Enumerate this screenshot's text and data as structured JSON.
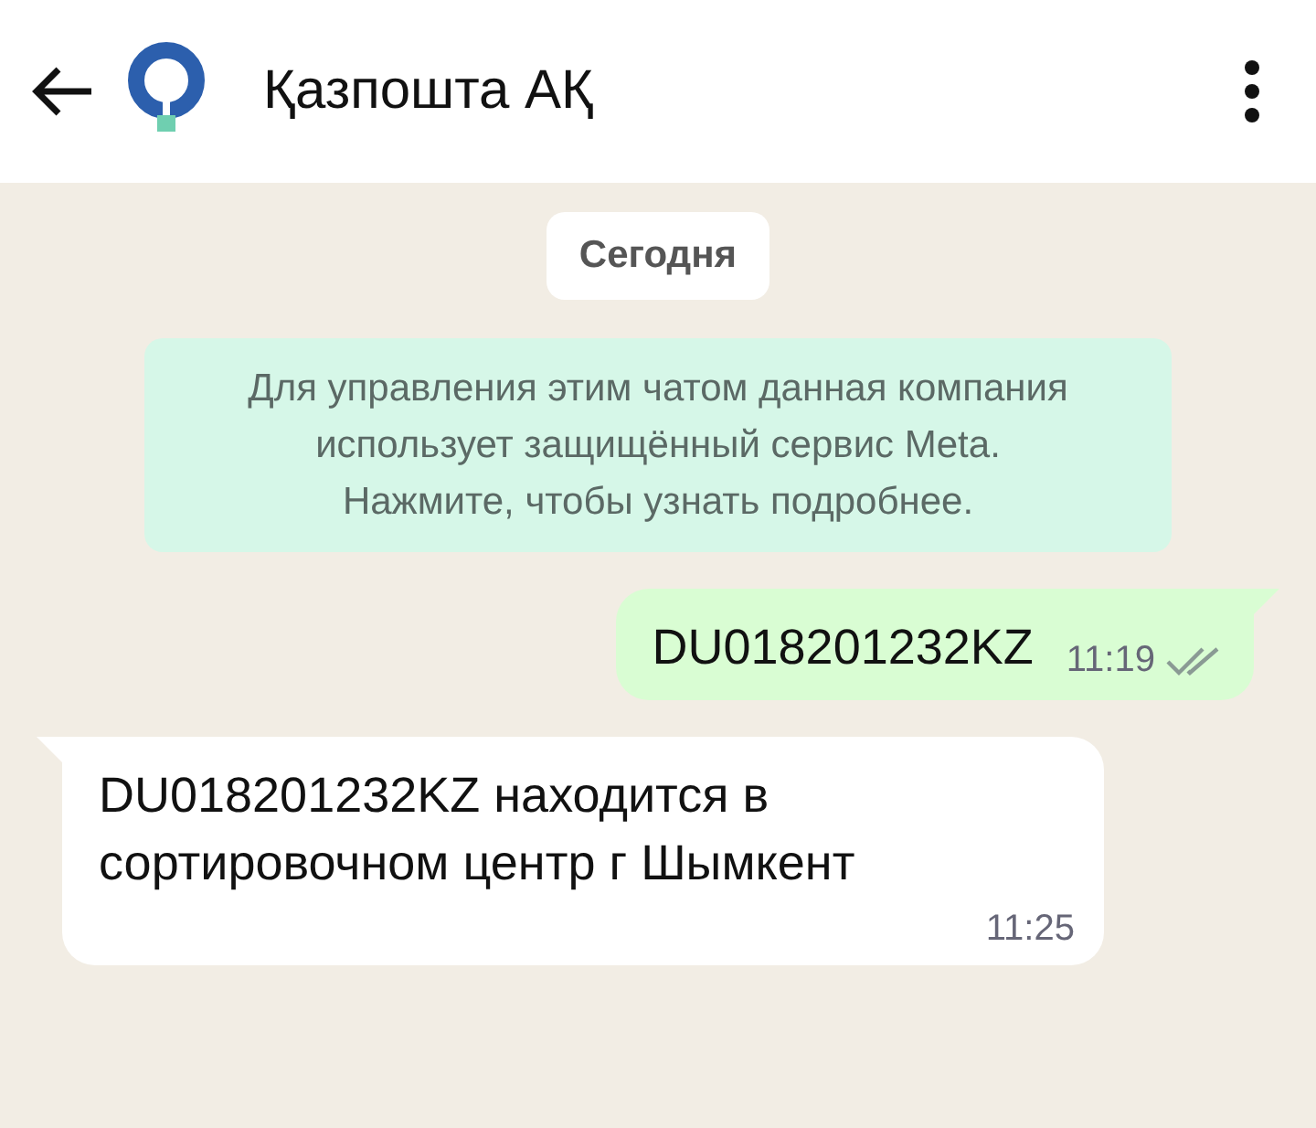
{
  "header": {
    "title": "Қазпошта АҚ"
  },
  "date_chip": "Сегодня",
  "notice": "Для управления этим чатом данная компания использует защищённый сервис Meta. Нажмите, чтобы узнать подробнее.",
  "messages": [
    {
      "kind": "outgoing",
      "text": "DU018201232KZ",
      "time": "11:19",
      "read": false
    },
    {
      "kind": "incoming",
      "text": "DU018201232KZ находится в сортировочном центр г Шымкент",
      "time": "11:25"
    }
  ]
}
